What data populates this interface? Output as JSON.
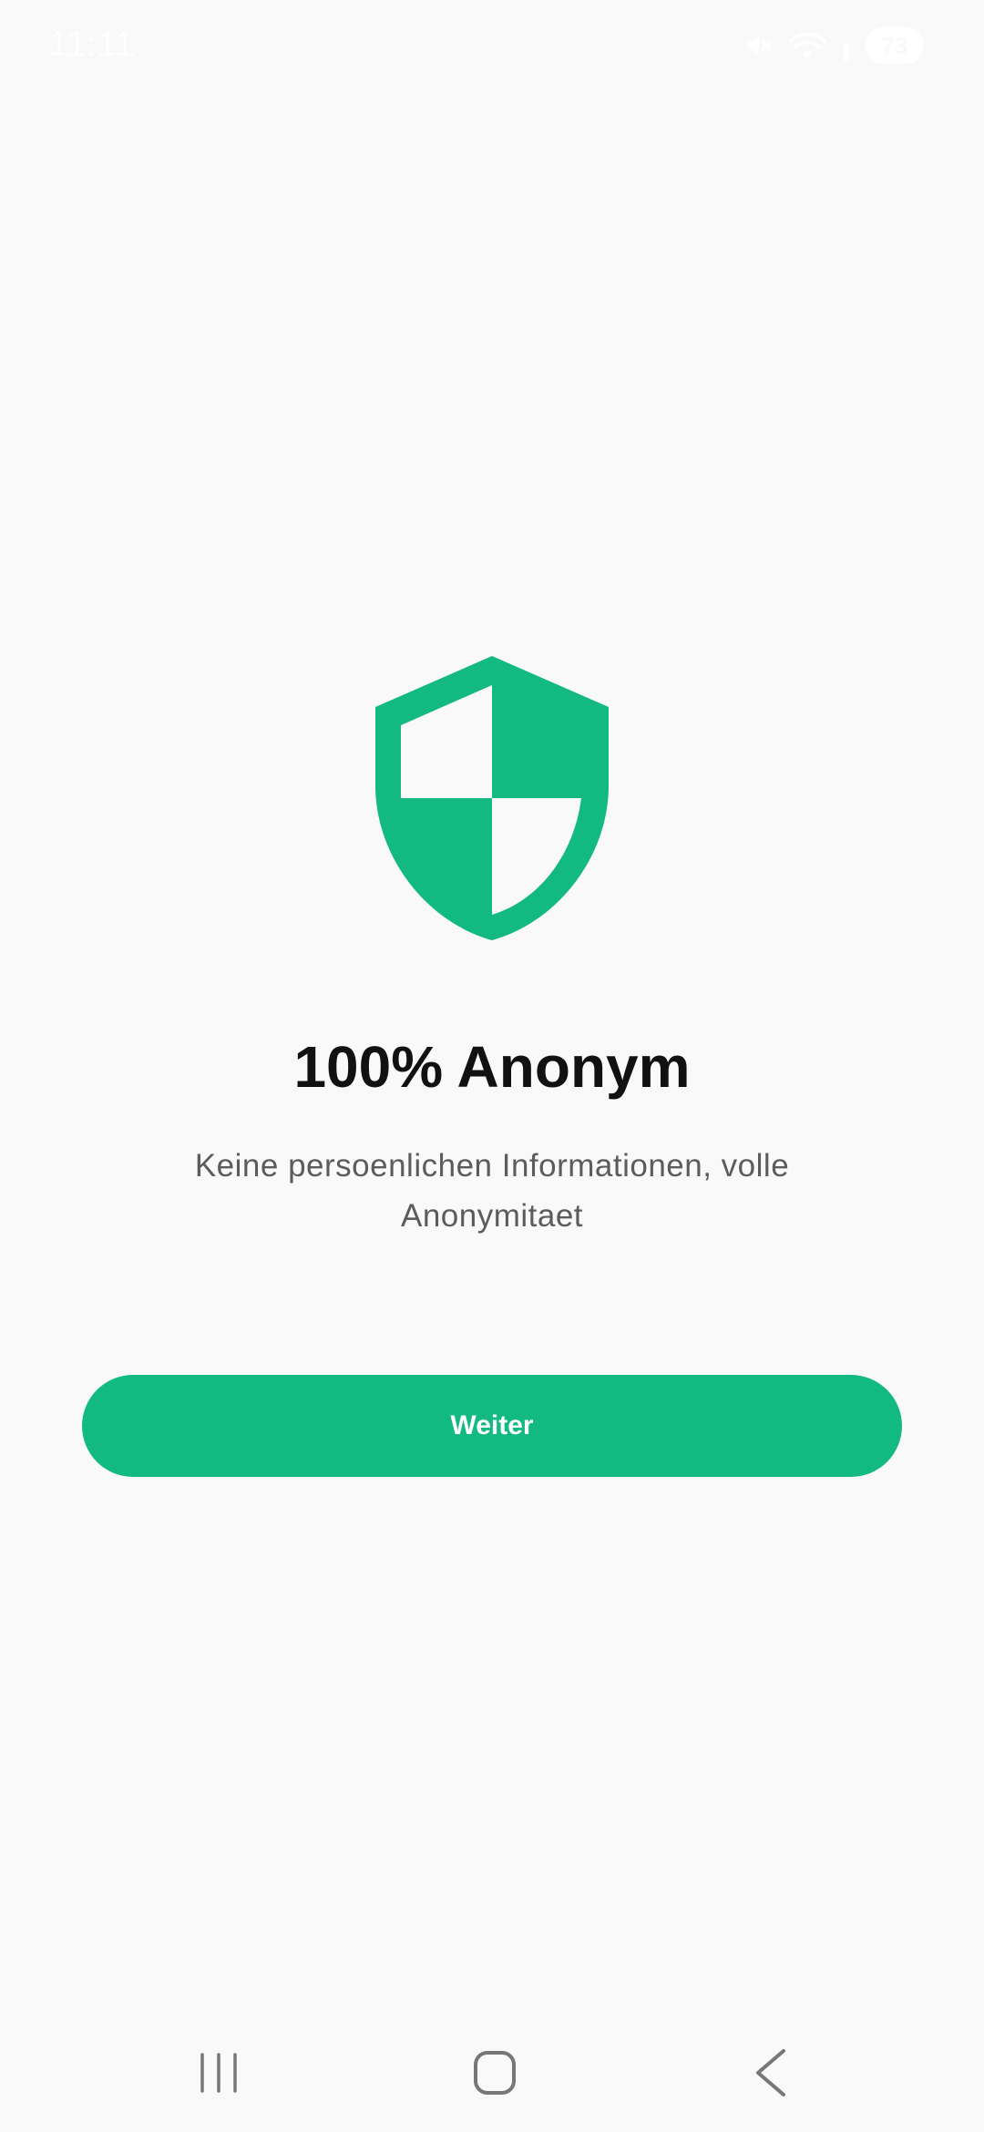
{
  "status_bar": {
    "time": "11:11",
    "battery": "73"
  },
  "onboarding": {
    "title": "100% Anonym",
    "subtitle": "Keine persoenlichen Informationen, volle Anonymitaet",
    "continue_label": "Weiter"
  },
  "icons": {
    "hero": "shield-icon",
    "status": [
      "mute-icon",
      "wifi-icon",
      "signal-icon",
      "battery-icon"
    ],
    "nav": [
      "recents-icon",
      "home-icon",
      "back-icon"
    ]
  },
  "colors": {
    "accent": "#12b981",
    "background": "#f9f9f9",
    "title": "#111111",
    "subtitle": "#5c5c5c"
  }
}
